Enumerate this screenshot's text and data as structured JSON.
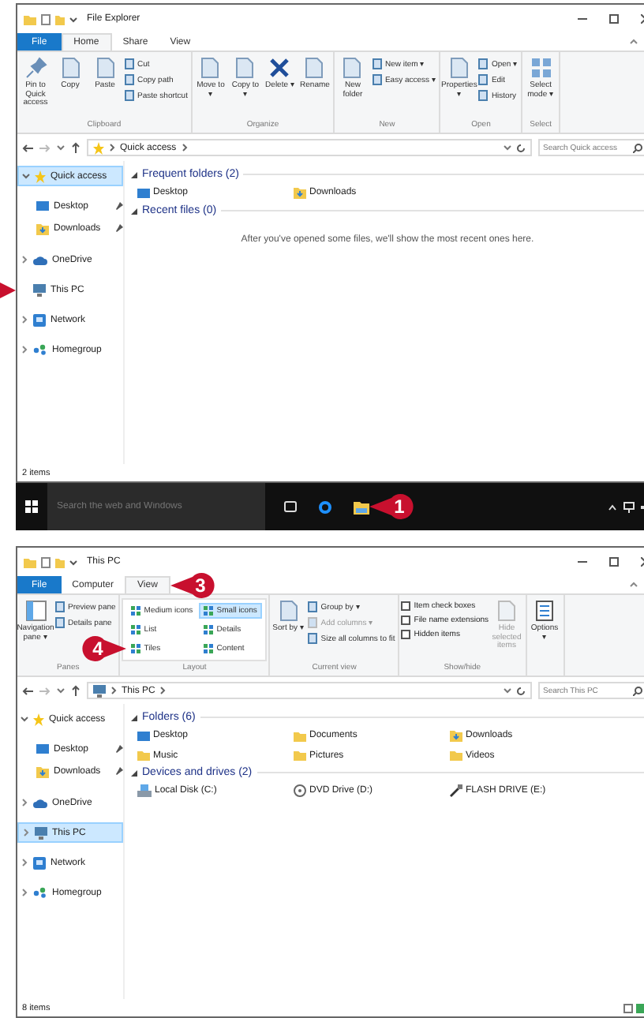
{
  "windows": [
    {
      "title": "File Explorer",
      "tabs": [
        {
          "label": "File",
          "kind": "file",
          "selected": false
        },
        {
          "label": "Home",
          "kind": "tab",
          "selected": true
        },
        {
          "label": "Share",
          "kind": "tab",
          "selected": false
        },
        {
          "label": "View",
          "kind": "tab",
          "selected": false
        }
      ],
      "ribbon": [
        {
          "label": "Clipboard",
          "items": [
            {
              "kind": "pin",
              "label": "Pin to Quick access"
            },
            {
              "kind": "large",
              "label": "Copy"
            },
            {
              "kind": "large",
              "label": "Paste"
            },
            {
              "kind": "small",
              "label": "Cut"
            },
            {
              "kind": "small",
              "label": "Copy path"
            },
            {
              "kind": "small",
              "label": "Paste shortcut"
            }
          ]
        },
        {
          "label": "Organize",
          "items": [
            {
              "kind": "large",
              "label": "Move to ▾"
            },
            {
              "kind": "large",
              "label": "Copy to ▾"
            },
            {
              "kind": "delete",
              "label": "Delete ▾"
            },
            {
              "kind": "large",
              "label": "Rename"
            }
          ]
        },
        {
          "label": "New",
          "items": [
            {
              "kind": "large",
              "label": "New folder"
            },
            {
              "kind": "small",
              "label": "New item ▾"
            },
            {
              "kind": "small",
              "label": "Easy access ▾"
            }
          ]
        },
        {
          "label": "Open",
          "items": [
            {
              "kind": "large",
              "label": "Properties ▾"
            },
            {
              "kind": "small",
              "label": "Open ▾"
            },
            {
              "kind": "small",
              "label": "Edit"
            },
            {
              "kind": "small",
              "label": "History"
            }
          ]
        },
        {
          "label": "Select",
          "items": [
            {
              "kind": "grid",
              "label": "Select mode ▾"
            }
          ]
        }
      ],
      "address": {
        "kind": "quick",
        "path": "Quick access"
      },
      "search": {
        "placeholder": "Search Quick access"
      },
      "nav": [
        {
          "label": "Quick access",
          "kind": "quick",
          "expanded": true,
          "selected": true,
          "children": [
            {
              "label": "Desktop",
              "kind": "desktop",
              "pinned": true,
              "selected": false
            },
            {
              "label": "Downloads",
              "kind": "downloads",
              "pinned": true,
              "selected": false
            }
          ]
        },
        {
          "label": "OneDrive",
          "kind": "cloud",
          "expanded": false,
          "selected": false
        },
        {
          "label": "This PC",
          "kind": "pc",
          "selected": false,
          "pointer": true
        },
        {
          "label": "Network",
          "kind": "network",
          "expanded": false,
          "selected": false
        },
        {
          "label": "Homegroup",
          "kind": "homegroup",
          "expanded": false,
          "selected": false
        }
      ],
      "sections": [
        {
          "title": "Frequent folders (2)",
          "expanded": true,
          "items": [
            {
              "label": "Desktop",
              "kind": "desktop"
            },
            {
              "label": "Downloads",
              "kind": "downloads"
            }
          ]
        },
        {
          "title": "Recent files (0)",
          "expanded": true,
          "message": "After you've opened some files, we'll show the most recent ones here."
        }
      ],
      "status": "2 items"
    },
    {
      "title": "This PC",
      "tabs": [
        {
          "label": "File",
          "kind": "file",
          "selected": false
        },
        {
          "label": "Computer",
          "kind": "tab",
          "selected": false
        },
        {
          "label": "View",
          "kind": "tab",
          "selected": true,
          "callout": {
            "number": "3"
          }
        }
      ],
      "ribbon": [
        {
          "label": "Panes",
          "items": [
            {
              "kind": "pane",
              "label": "Navigation pane ▾"
            },
            {
              "kind": "small",
              "label": "Preview pane"
            },
            {
              "kind": "small",
              "label": "Details pane"
            }
          ]
        },
        {
          "label": "Layout",
          "items": [
            {
              "kind": "gallery",
              "label": "Medium icons",
              "selected": false
            },
            {
              "kind": "gallery",
              "label": "Small icons",
              "selected": true
            },
            {
              "kind": "gallery",
              "label": "List",
              "selected": false
            },
            {
              "kind": "gallery",
              "label": "Details",
              "selected": false
            },
            {
              "kind": "gallery",
              "label": "Tiles",
              "selected": false,
              "callout": {
                "number": "4"
              }
            },
            {
              "kind": "gallery",
              "label": "Content",
              "selected": false
            }
          ]
        },
        {
          "label": "Current view",
          "items": [
            {
              "kind": "large",
              "label": "Sort by ▾"
            },
            {
              "kind": "small",
              "label": "Group by ▾"
            },
            {
              "kind": "small",
              "label": "Add columns ▾",
              "disabled": true
            },
            {
              "kind": "small",
              "label": "Size all columns to fit"
            }
          ]
        },
        {
          "label": "Show/hide",
          "items": [
            {
              "kind": "checkbox",
              "label": "Item check boxes",
              "checked": false
            },
            {
              "kind": "checkbox",
              "label": "File name extensions",
              "checked": false
            },
            {
              "kind": "checkbox",
              "label": "Hidden items",
              "checked": false
            },
            {
              "kind": "large",
              "label": "Hide selected items",
              "disabled": true
            }
          ]
        },
        {
          "items": [
            {
              "kind": "options",
              "label": "Options ▾"
            }
          ]
        }
      ],
      "address": {
        "kind": "pc",
        "path": "This PC"
      },
      "search": {
        "placeholder": "Search This PC"
      },
      "nav": [
        {
          "label": "Quick access",
          "kind": "quick",
          "expanded": true,
          "selected": false,
          "children": [
            {
              "label": "Desktop",
              "kind": "desktop",
              "pinned": true,
              "selected": false
            },
            {
              "label": "Downloads",
              "kind": "downloads",
              "pinned": true,
              "selected": false
            }
          ]
        },
        {
          "label": "OneDrive",
          "kind": "cloud",
          "expanded": false,
          "selected": false
        },
        {
          "label": "This PC",
          "kind": "pc",
          "expanded": false,
          "selected": true
        },
        {
          "label": "Network",
          "kind": "network",
          "expanded": false,
          "selected": false
        },
        {
          "label": "Homegroup",
          "kind": "homegroup",
          "expanded": false,
          "selected": false
        }
      ],
      "sections": [
        {
          "title": "Folders (6)",
          "expanded": true,
          "items": [
            {
              "label": "Desktop",
              "kind": "desktop"
            },
            {
              "label": "Documents",
              "kind": "folder"
            },
            {
              "label": "Downloads",
              "kind": "downloads"
            },
            {
              "label": "Music",
              "kind": "folder"
            },
            {
              "label": "Pictures",
              "kind": "folder"
            },
            {
              "label": "Videos",
              "kind": "folder"
            }
          ]
        },
        {
          "title": "Devices and drives (2)",
          "expanded": true,
          "items": [
            {
              "label": "Local Disk (C:)",
              "kind": "drive"
            },
            {
              "label": "DVD Drive (D:)",
              "kind": "disc"
            },
            {
              "label": "FLASH DRIVE (E:)",
              "kind": "usb"
            }
          ]
        }
      ],
      "status": "8 items",
      "view_switch": true
    }
  ],
  "taskbar": {
    "search": {
      "placeholder": "Search the web and Windows"
    },
    "apps": [
      {
        "kind": "taskview"
      },
      {
        "kind": "browser"
      },
      {
        "kind": "explorer",
        "callout": {
          "number": "1"
        }
      }
    ]
  }
}
